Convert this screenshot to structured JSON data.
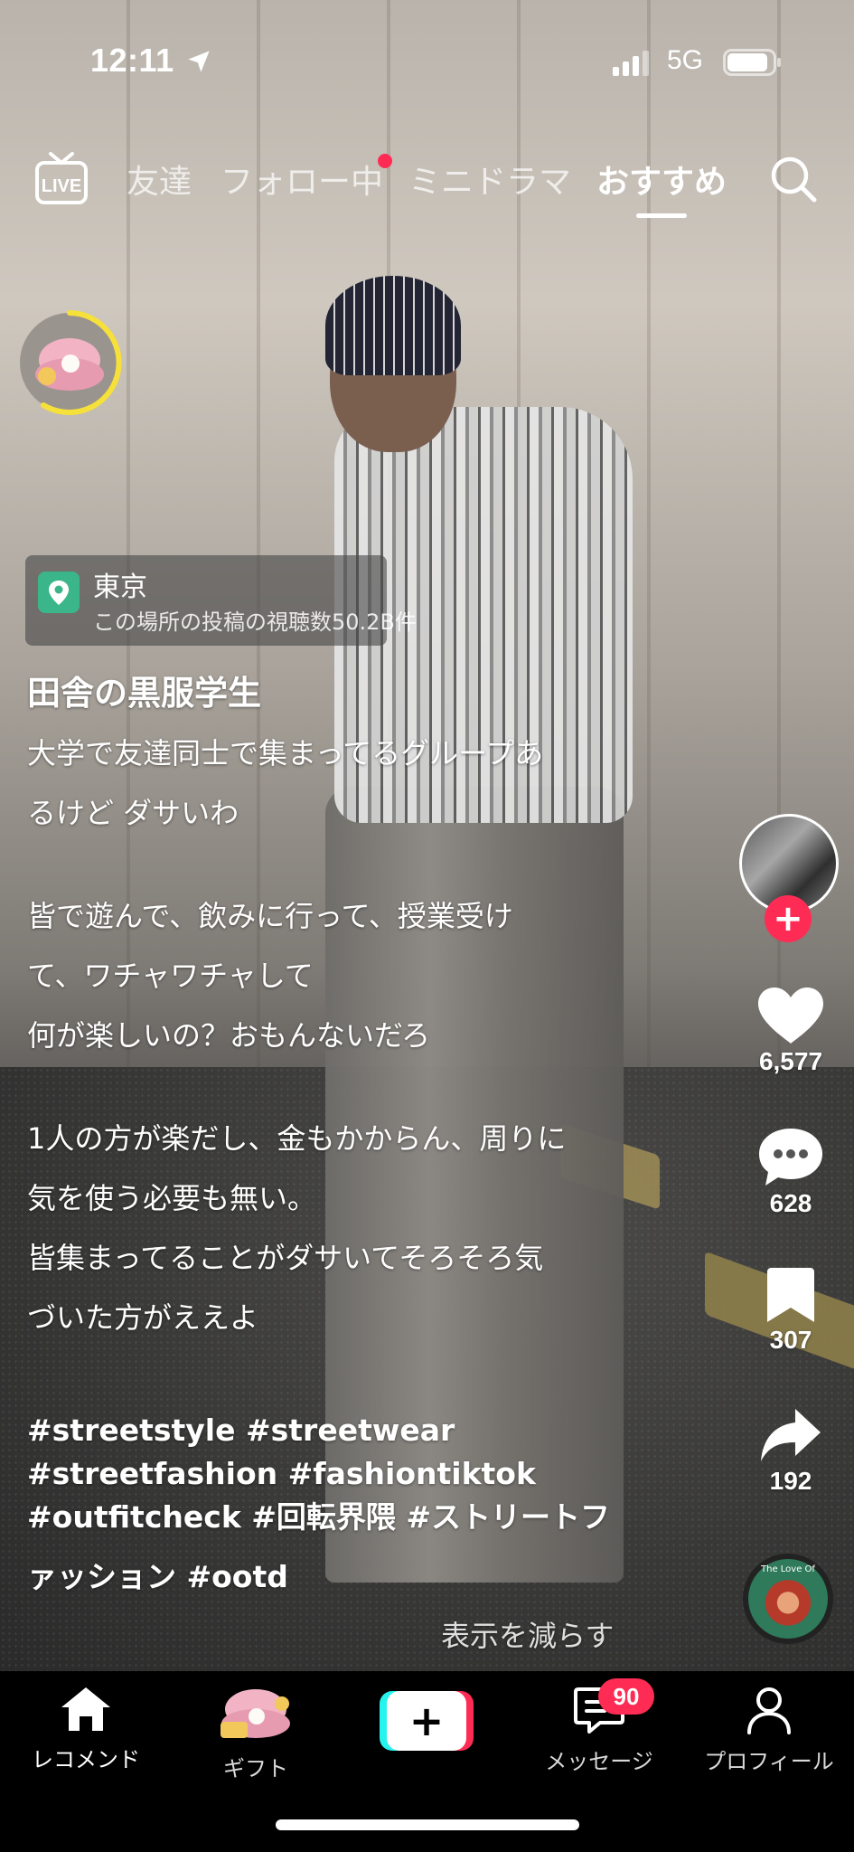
{
  "status_bar": {
    "time": "12:11",
    "network": "5G"
  },
  "top_nav": {
    "tabs": [
      {
        "label": "友達",
        "active": false
      },
      {
        "label": "フォロー中",
        "active": false,
        "has_dot": true
      },
      {
        "label": "ミニドラマ",
        "active": false
      },
      {
        "label": "おすすめ",
        "active": true
      }
    ],
    "live_label": "LIVE"
  },
  "post": {
    "location": {
      "name": "東京",
      "views_text": "この場所の投稿の視聴数50.2B件"
    },
    "author": "田舎の黒服学生",
    "description_lines": [
      "大学で友達同士で集まってるグループあ",
      "るけど ダサいわ",
      "",
      " 皆で遊んで、飲みに行って、授業受け",
      "て、ワチャワチャして",
      "何が楽しいの？おもんないだろ",
      "",
      "1人の方が楽だし、金もかからん、周りに",
      "気を使う必要も無い。",
      " 皆集まってることがダサいてそろそろ気",
      "づいた方がええよ"
    ],
    "hashtag_lines": [
      "#streetstyle #streetwear",
      "#streetfashion #fashiontiktok",
      "#outfitcheck #回転界隈 #ストリートフ",
      "ァッション #ootd"
    ],
    "show_less": "表示を減らす",
    "music_disc_text": "The Love Of"
  },
  "actions": {
    "likes": "6,577",
    "comments": "628",
    "saves": "307",
    "shares": "192"
  },
  "bottom_nav": {
    "home": "レコメンド",
    "gift": "ギフト",
    "messages": "メッセージ",
    "messages_badge": "90",
    "profile": "プロフィール"
  },
  "colors": {
    "accent": "#fe2c55",
    "cyan": "#25f4ee",
    "location_pin": "#3bb58a"
  }
}
